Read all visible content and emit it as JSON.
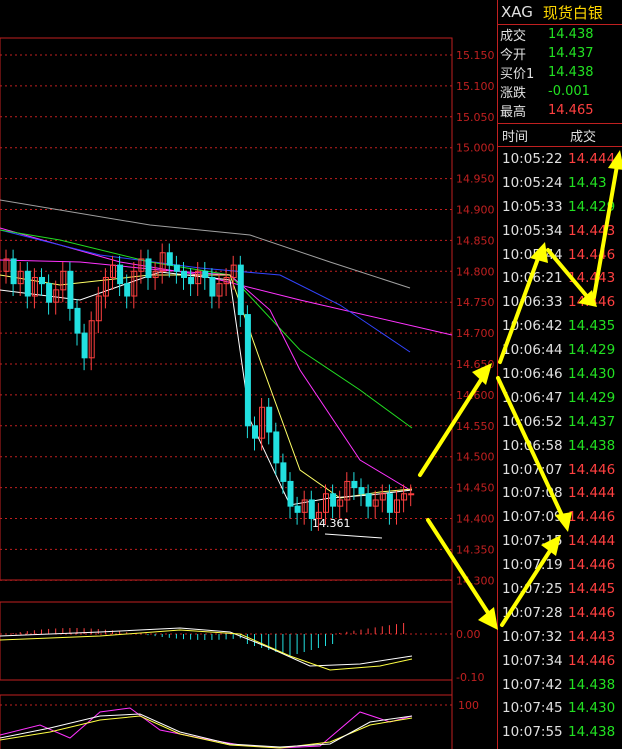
{
  "instrument": {
    "code": "XAG",
    "name": "现货白银"
  },
  "quote": [
    {
      "label": "成交",
      "value": "14.438",
      "color": "green"
    },
    {
      "label": "今开",
      "value": "14.437",
      "color": "green"
    },
    {
      "label": "买价1",
      "value": "14.438",
      "color": "green"
    },
    {
      "label": "涨跌",
      "value": "-0.001",
      "color": "green"
    },
    {
      "label": "最高",
      "value": "14.465",
      "color": "red"
    }
  ],
  "ticks_header": {
    "time": "时间",
    "price": "成交"
  },
  "ticks": [
    {
      "time": "10:05:22",
      "price": "14.444",
      "color": "red"
    },
    {
      "time": "10:05:24",
      "price": "14.43",
      "color": "green"
    },
    {
      "time": "10:05:33",
      "price": "14.429",
      "color": "green"
    },
    {
      "time": "10:05:34",
      "price": "14.443",
      "color": "red"
    },
    {
      "time": "10:05:44",
      "price": "14.446",
      "color": "red"
    },
    {
      "time": "10:06:21",
      "price": "14.443",
      "color": "red"
    },
    {
      "time": "10:06:33",
      "price": "14.446",
      "color": "red"
    },
    {
      "time": "10:06:42",
      "price": "14.435",
      "color": "green"
    },
    {
      "time": "10:06:44",
      "price": "14.429",
      "color": "green"
    },
    {
      "time": "10:06:46",
      "price": "14.430",
      "color": "green"
    },
    {
      "time": "10:06:47",
      "price": "14.429",
      "color": "green"
    },
    {
      "time": "10:06:52",
      "price": "14.437",
      "color": "green"
    },
    {
      "time": "10:06:58",
      "price": "14.438",
      "color": "green"
    },
    {
      "time": "10:07:07",
      "price": "14.446",
      "color": "red"
    },
    {
      "time": "10:07:08",
      "price": "14.444",
      "color": "red"
    },
    {
      "time": "10:07:09",
      "price": "14.446",
      "color": "red"
    },
    {
      "time": "10:07:15",
      "price": "14.444",
      "color": "red"
    },
    {
      "time": "10:07:19",
      "price": "14.446",
      "color": "red"
    },
    {
      "time": "10:07:25",
      "price": "14.445",
      "color": "red"
    },
    {
      "time": "10:07:28",
      "price": "14.446",
      "color": "red"
    },
    {
      "time": "10:07:32",
      "price": "14.443",
      "color": "red"
    },
    {
      "time": "10:07:34",
      "price": "14.446",
      "color": "red"
    },
    {
      "time": "10:07:42",
      "price": "14.438",
      "color": "green"
    },
    {
      "time": "10:07:45",
      "price": "14.430",
      "color": "green"
    },
    {
      "time": "10:07:55",
      "price": "14.438",
      "color": "green"
    }
  ],
  "chart": {
    "price_axis": [
      "15.150",
      "15.100",
      "15.050",
      "15.000",
      "14.950",
      "14.900",
      "14.850",
      "14.800",
      "14.750",
      "14.700",
      "14.650",
      "14.600",
      "14.550",
      "14.500",
      "14.450",
      "14.400",
      "14.350",
      "14.300"
    ],
    "low_label": "14.361",
    "macd_axis": [
      "0.00",
      "-0.10"
    ],
    "kdj_axis": [
      "100"
    ]
  },
  "colors": {
    "up": "#ff4040",
    "down": "#22e0e0",
    "grid": "#c02020",
    "arrow": "#ffff00"
  }
}
